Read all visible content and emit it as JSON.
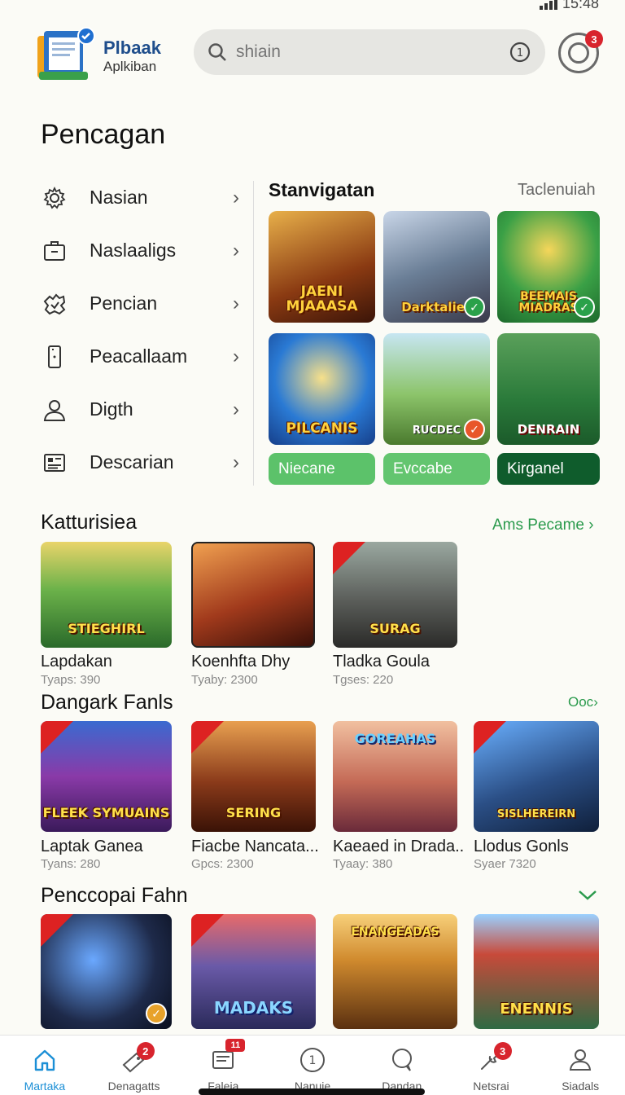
{
  "status": {
    "time": "15:48"
  },
  "header": {
    "app_name": "Plbaak",
    "app_subtitle": "Aplkiban",
    "search_placeholder": "shiain",
    "profile_badge": "3"
  },
  "page_title": "Pencagan",
  "menu": [
    {
      "label": "Nasian",
      "icon": "gear-icon"
    },
    {
      "label": "Naslaaligs",
      "icon": "briefcase-icon"
    },
    {
      "label": "Pencian",
      "icon": "puzzle-icon"
    },
    {
      "label": "Peacallaam",
      "icon": "device-icon"
    },
    {
      "label": "Digth",
      "icon": "user-icon"
    },
    {
      "label": "Descarian",
      "icon": "document-icon"
    }
  ],
  "featured": {
    "title": "Stanvigatan",
    "link": "Taclenuiah",
    "tiles": [
      {
        "art": "JAENI MJAAASA",
        "checked": false,
        "bg": "#8a3a12"
      },
      {
        "art": "Darktalies",
        "checked": true,
        "bg": "#5e6a7e"
      },
      {
        "art": "BEEMAIS MIADRAS",
        "checked": true,
        "bg": "#2b8c3a"
      },
      {
        "art": "PILCANIS",
        "checked": false,
        "bg": "#1f6fc2"
      },
      {
        "art": "RUCDEC",
        "checked": true,
        "bg": "#6da34a"
      },
      {
        "art": "DENRAIN",
        "checked": false,
        "bg": "#25833a"
      }
    ],
    "chips": [
      {
        "label": "Niecane",
        "color": "#5cc26a"
      },
      {
        "label": "Evccabe",
        "color": "#63c56f"
      },
      {
        "label": "Kirganel",
        "color": "#0f5c2c"
      }
    ]
  },
  "sections": [
    {
      "title": "Katturisiea",
      "link": "Ams Pecame",
      "cards": [
        {
          "name": "Lapdakan",
          "meta": "Tyaps: 390",
          "art": "STIEGHIRL",
          "bg": "#3f8f3a"
        },
        {
          "name": "Koenhfta Dhy",
          "meta": "Tyaby: 2300",
          "art": "",
          "bg": "#a13a1c"
        },
        {
          "name": "Tladka Goula",
          "meta": "Tgses: 220",
          "art": "SURAG",
          "bg": "#5b5e5a"
        }
      ]
    },
    {
      "title": "Dangark Fanls",
      "link": "Ooc",
      "cards": [
        {
          "name": "Laptak Ganea",
          "meta": "Tyans: 280",
          "art": "FLEEK SYMUAINS",
          "bg": "#5a2f7a"
        },
        {
          "name": "Fiacbe Nancata...",
          "meta": "Gpcs: 2300",
          "art": "SERING",
          "bg": "#8a3a1a"
        },
        {
          "name": "Kaeaed in Drada..",
          "meta": "Tyaay: 380",
          "art": "GOREAHAS",
          "bg": "#c46a56"
        },
        {
          "name": "Llodus Gonls",
          "meta": "Syaer 7320",
          "art": "SISLHEREIRN",
          "bg": "#2b4f86"
        }
      ]
    },
    {
      "title": "Penccopai Fahn",
      "cards": [
        {
          "name": "",
          "meta": "",
          "art": "",
          "bg": "#1e2a4a"
        },
        {
          "name": "",
          "meta": "",
          "art": "MADAKS",
          "bg": "#4a5a9a"
        },
        {
          "name": "",
          "meta": "",
          "art": "ENANGEADAS",
          "bg": "#d08a2e"
        },
        {
          "name": "",
          "meta": "",
          "art": "ENENNIS",
          "bg": "#2f6a44"
        }
      ]
    }
  ],
  "bottom_nav": [
    {
      "label": "Martaka",
      "icon": "home-icon",
      "badge": "",
      "active": true
    },
    {
      "label": "Denagatts",
      "icon": "tag-icon",
      "badge": "2",
      "active": false
    },
    {
      "label": "Faleia",
      "icon": "inbox-icon",
      "badge": "11",
      "active": false
    },
    {
      "label": "Nanuie",
      "icon": "number-icon",
      "badge": "",
      "active": false
    },
    {
      "label": "Dandan",
      "icon": "chat-icon",
      "badge": "",
      "active": false
    },
    {
      "label": "Netsrai",
      "icon": "wrench-icon",
      "badge": "3",
      "active": false
    },
    {
      "label": "Siadals",
      "icon": "profile-icon",
      "badge": "",
      "active": false
    }
  ],
  "colors": {
    "accent_green": "#2a9a4c",
    "active_blue": "#1b8fd6",
    "badge_red": "#d8242d"
  }
}
